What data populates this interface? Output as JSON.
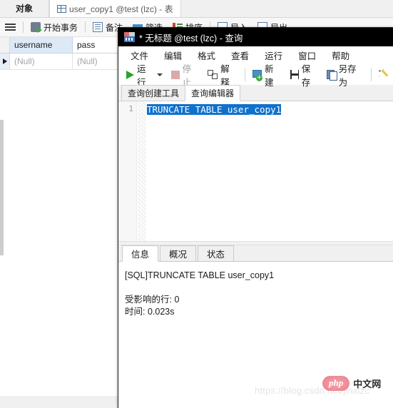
{
  "background_window": {
    "tabs": [
      {
        "label": "对象",
        "icon": "",
        "active": false
      },
      {
        "label": "user_copy1 @test (lzc) - 表",
        "icon": "table-grid-icon",
        "active": true
      }
    ],
    "toolbar": [
      {
        "label": "",
        "icon": "hamburger-menu-icon"
      },
      {
        "label": "开始事务",
        "icon": "begin-transaction-icon"
      },
      {
        "label": "备注",
        "icon": "note-icon"
      },
      {
        "label": "筛选",
        "icon": "filter-icon"
      },
      {
        "label": "排序",
        "icon": "sort-icon"
      },
      {
        "label": "导入",
        "icon": "import-icon"
      },
      {
        "label": "导出",
        "icon": "export-icon"
      }
    ],
    "grid": {
      "columns": [
        "username",
        "pass"
      ],
      "rows": [
        [
          "(Null)",
          "(Null)"
        ]
      ]
    }
  },
  "query_window": {
    "title": "* 无标题 @test (lzc) - 查询",
    "title_icon": "query-window-icon",
    "menu": [
      "文件",
      "编辑",
      "格式",
      "查看",
      "运行",
      "窗口",
      "帮助"
    ],
    "toolbar": [
      {
        "label": "运行",
        "icon": "run-play-icon",
        "disabled": false,
        "dropdown": true
      },
      {
        "label": "停止",
        "icon": "stop-square-icon",
        "disabled": true,
        "dropdown": false
      },
      {
        "label": "解释",
        "icon": "explain-icon",
        "disabled": false,
        "dropdown": false
      },
      {
        "label": "新建",
        "icon": "new-query-icon",
        "disabled": false,
        "dropdown": false
      },
      {
        "label": "保存",
        "icon": "save-disk-icon",
        "disabled": false,
        "dropdown": false
      },
      {
        "label": "另存为",
        "icon": "save-as-icon",
        "disabled": false,
        "dropdown": false
      },
      {
        "label": "",
        "icon": "beautify-wand-icon",
        "disabled": false,
        "dropdown": false
      }
    ],
    "editor_tabs": [
      {
        "label": "查询创建工具",
        "active": false
      },
      {
        "label": "查询编辑器",
        "active": true
      }
    ],
    "editor": {
      "line_number": "1",
      "sql": "TRUNCATE TABLE user_copy1",
      "selection_color": "#0f71cd"
    },
    "result_tabs": [
      {
        "label": "信息",
        "active": true
      },
      {
        "label": "概况",
        "active": false
      },
      {
        "label": "状态",
        "active": false
      }
    ],
    "result_lines": [
      "[SQL]TRUNCATE TABLE user_copy1",
      "",
      "受影响的行: 0",
      "时间: 0.023s"
    ]
  },
  "watermark": {
    "url": "https://blog.csdn.net/jinxlzc",
    "logo_text": "php",
    "logo_suffix": "中文网"
  }
}
